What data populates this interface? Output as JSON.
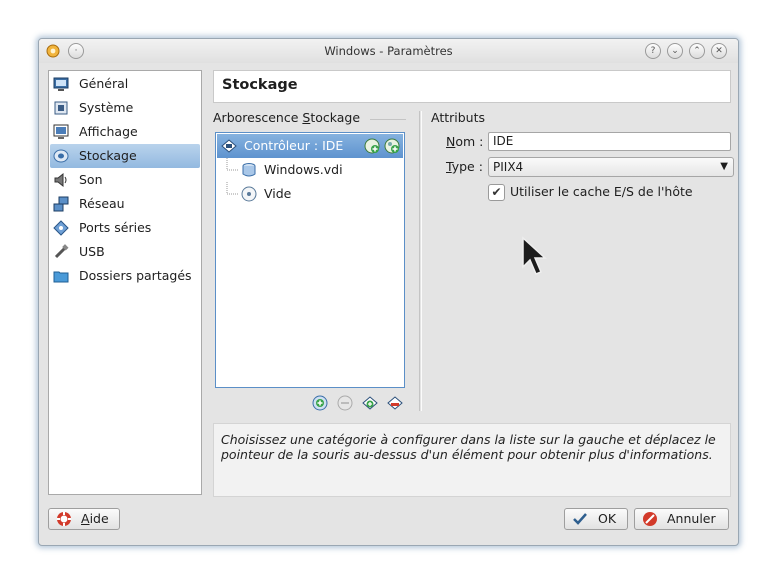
{
  "window": {
    "title": "Windows - Paramètres",
    "buttons": [
      {
        "name": "help-title-button",
        "icon": "question-icon",
        "glyph": "?"
      },
      {
        "name": "minimize-button",
        "icon": "chevron-down-icon",
        "glyph": "⌄"
      },
      {
        "name": "maximize-button",
        "icon": "chevron-up-icon",
        "glyph": "⌃"
      },
      {
        "name": "close-button",
        "icon": "close-icon",
        "glyph": "✕"
      }
    ]
  },
  "sidebar": {
    "items": [
      {
        "label": "Général",
        "icon": "monitor-icon",
        "selected": false
      },
      {
        "label": "Système",
        "icon": "chip-icon",
        "selected": false
      },
      {
        "label": "Affichage",
        "icon": "display-icon",
        "selected": false
      },
      {
        "label": "Stockage",
        "icon": "disk-icon",
        "selected": true
      },
      {
        "label": "Son",
        "icon": "speaker-icon",
        "selected": false
      },
      {
        "label": "Réseau",
        "icon": "network-icon",
        "selected": false
      },
      {
        "label": "Ports séries",
        "icon": "serial-port-icon",
        "selected": false
      },
      {
        "label": "USB",
        "icon": "usb-icon",
        "selected": false
      },
      {
        "label": "Dossiers partagés",
        "icon": "folder-icon",
        "selected": false
      }
    ]
  },
  "page": {
    "title": "Stockage"
  },
  "storage_tree": {
    "label_before": "Arborescence ",
    "label_mnemonic": "S",
    "label_after": "tockage",
    "controller": {
      "label": "Contrôleur : IDE",
      "icon": "ide-controller-icon"
    },
    "children": [
      {
        "label": "Windows.vdi",
        "icon": "hard-disk-icon"
      },
      {
        "label": "Vide",
        "icon": "optical-disc-icon"
      }
    ],
    "row_buttons": [
      {
        "name": "add-hard-disk-button",
        "icon": "add-hard-disk-icon"
      },
      {
        "name": "add-cd-button",
        "icon": "add-cd-icon"
      }
    ],
    "bottom_buttons": [
      {
        "name": "add-controller-button",
        "icon": "add-controller-icon",
        "enabled": true
      },
      {
        "name": "remove-controller-button",
        "icon": "remove-controller-icon",
        "enabled": false
      },
      {
        "name": "add-attachment-button",
        "icon": "add-attachment-icon",
        "enabled": true
      },
      {
        "name": "remove-attachment-button",
        "icon": "remove-attachment-icon",
        "enabled": true
      }
    ]
  },
  "attributes": {
    "heading": "Attributs",
    "name_mnemonic": "N",
    "name_rest": "om :",
    "name_value": "IDE",
    "type_mnemonic": "T",
    "type_rest": "ype :",
    "type_value": "PIIX4",
    "cache_label": "Utiliser le cache E/S de l'hôte",
    "cache_checked": true
  },
  "info_text": "Choisissez une catégorie à configurer dans la liste sur la gauche et déplacez le pointeur de la souris au-dessus d'un élément pour obtenir plus d'informations.",
  "footer": {
    "help_mnemonic": "A",
    "help_rest": "ide",
    "ok_label": "OK",
    "cancel_label": "Annuler"
  },
  "colors": {
    "selection": "#93b9e0",
    "tree_selection": "#5e93cf",
    "accent_green": "#3aa34a",
    "cancel_red": "#d23a2a"
  }
}
